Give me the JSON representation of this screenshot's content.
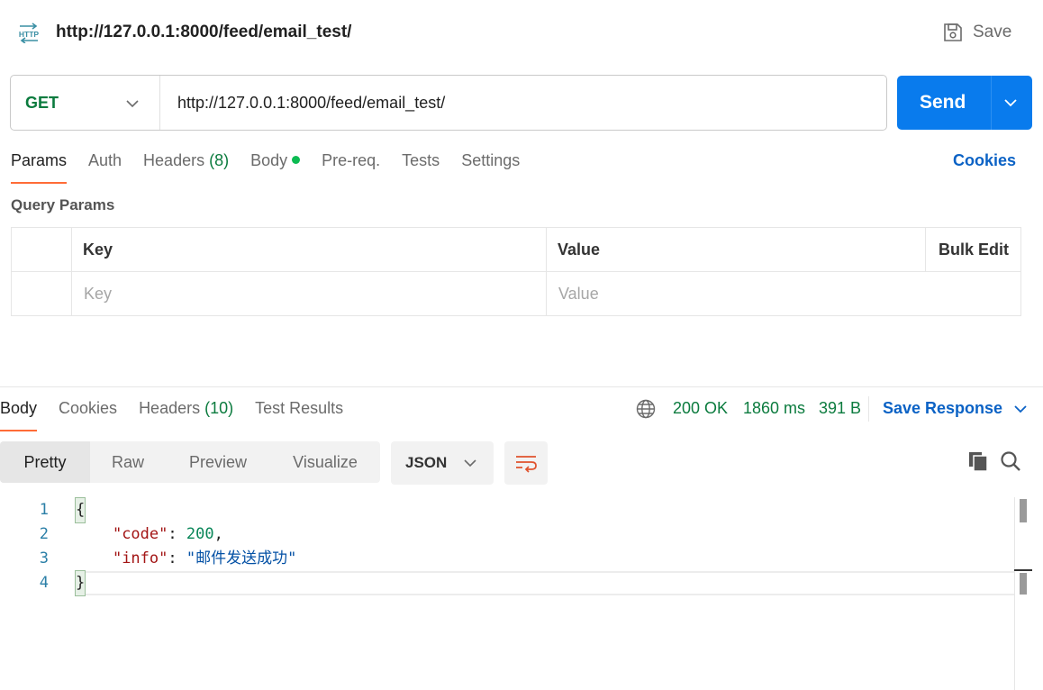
{
  "header": {
    "icon": "http-icon",
    "icon_text": "HTTP",
    "title": "http://127.0.0.1:8000/feed/email_test/",
    "save_label": "Save"
  },
  "request": {
    "method": "GET",
    "url": "http://127.0.0.1:8000/feed/email_test/",
    "send_label": "Send",
    "tabs": [
      {
        "label": "Params",
        "active": true
      },
      {
        "label": "Auth"
      },
      {
        "label": "Headers",
        "count": "(8)"
      },
      {
        "label": "Body",
        "indicator": "dot"
      },
      {
        "label": "Pre-req."
      },
      {
        "label": "Tests"
      },
      {
        "label": "Settings"
      }
    ],
    "cookies_label": "Cookies",
    "query_params_title": "Query Params",
    "table": {
      "headers": {
        "key": "Key",
        "value": "Value",
        "bulk_edit": "Bulk Edit"
      },
      "placeholders": {
        "key": "Key",
        "value": "Value"
      }
    }
  },
  "response": {
    "tabs": [
      {
        "label": "Body",
        "active": true
      },
      {
        "label": "Cookies"
      },
      {
        "label": "Headers",
        "count": "(10)"
      },
      {
        "label": "Test Results"
      }
    ],
    "status": "200 OK",
    "time": "1860 ms",
    "size": "391 B",
    "save_response_label": "Save Response",
    "formats": [
      "Pretty",
      "Raw",
      "Preview",
      "Visualize"
    ],
    "active_format": "Pretty",
    "language": "JSON",
    "code_lines": [
      {
        "n": "1",
        "text": "{"
      },
      {
        "n": "2",
        "key": "\"code\"",
        "sep": ": ",
        "value": "200",
        "end": ","
      },
      {
        "n": "3",
        "key": "\"info\"",
        "sep": ": ",
        "value": "\"邮件发送成功\"",
        "end": ""
      },
      {
        "n": "4",
        "text": "}"
      }
    ]
  },
  "colors": {
    "accent_orange": "#ff6c37",
    "send_blue": "#097bed",
    "link_blue": "#0b62c5",
    "success_green": "#0b7b3e"
  }
}
